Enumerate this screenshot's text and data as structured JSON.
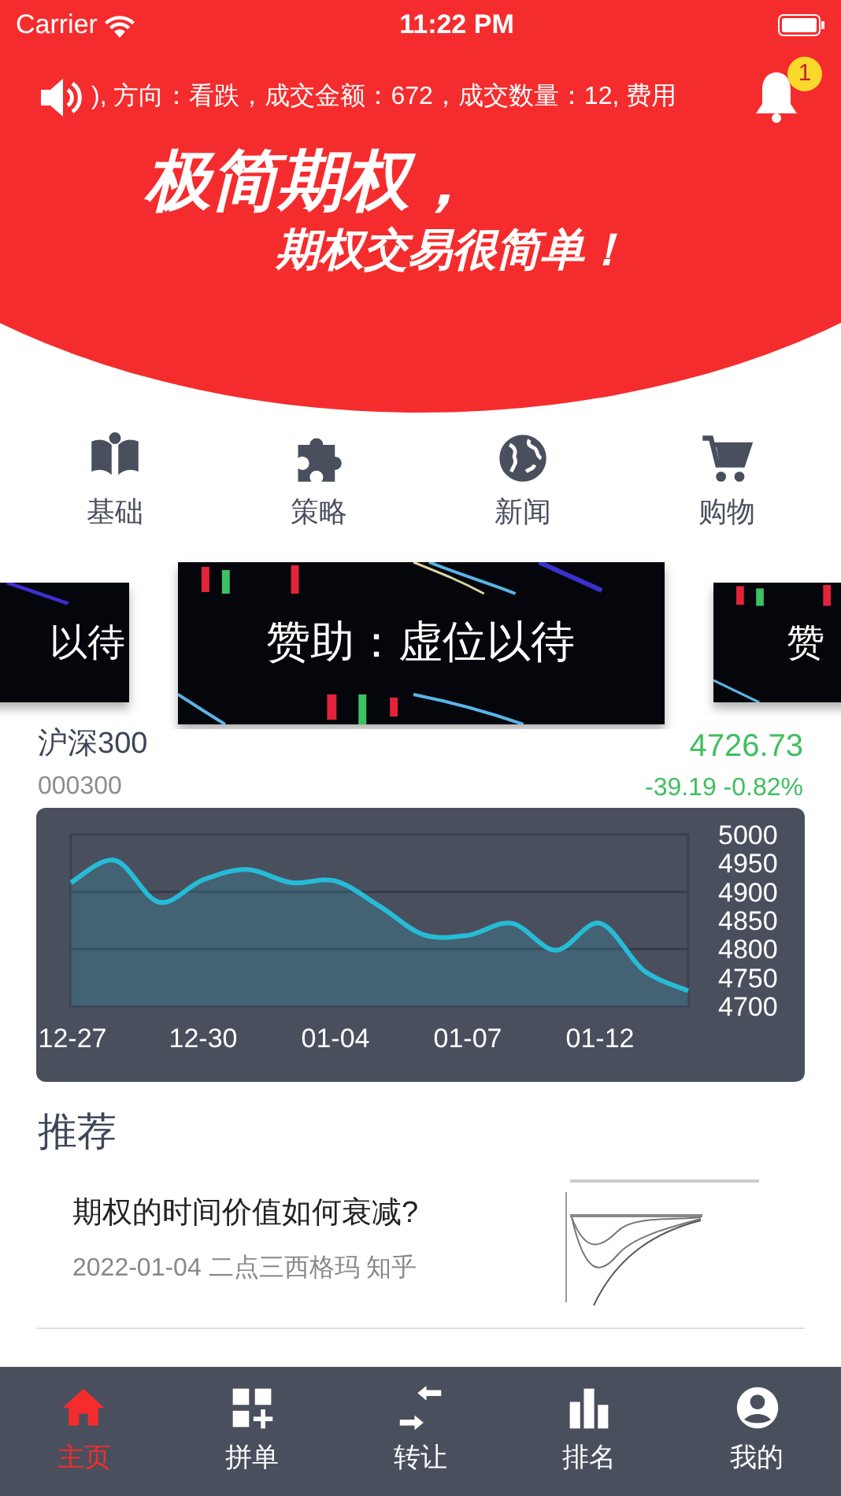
{
  "status_bar": {
    "carrier": "Carrier",
    "time": "11:22 PM"
  },
  "header": {
    "ticker": "), 方向：看跌，成交金额：672，成交数量：12, 费用",
    "notification_count": "1",
    "slogan_line_1": "极简期权，",
    "slogan_line_2": "期权交易很简单！"
  },
  "shortcuts": [
    {
      "kind": "book",
      "label": "基础"
    },
    {
      "kind": "puzzle",
      "label": "策略"
    },
    {
      "kind": "globe",
      "label": "新闻"
    },
    {
      "kind": "cart",
      "label": "购物"
    }
  ],
  "banners": [
    {
      "kind": "side-left",
      "caption": "以待"
    },
    {
      "kind": "center",
      "caption": "赞助：虚位以待"
    },
    {
      "kind": "side-right",
      "caption": "赞"
    }
  ],
  "index": {
    "name": "沪深300",
    "code": "000300",
    "price": "4726.73",
    "change": "-39.19 -0.82%"
  },
  "chart": {
    "chart_data": {
      "type": "area",
      "categories": [
        "12-27",
        null,
        null,
        "12-30",
        null,
        null,
        "01-04",
        null,
        null,
        "01-07",
        null,
        null,
        "01-12",
        null,
        null
      ],
      "series": [
        {
          "color": "#26bcd7",
          "values": [
            4916,
            4955,
            4882,
            4921,
            4939,
            4916,
            4919,
            4875,
            4825,
            4824,
            4845,
            4798,
            4845,
            4762,
            4727
          ]
        }
      ],
      "ylim": [
        4700,
        5000
      ],
      "yticks": [
        4700,
        4750,
        4800,
        4850,
        4900,
        4950,
        5000
      ]
    }
  },
  "recommend": {
    "heading": "推荐",
    "articles": [
      {
        "title": "期权的时间价值如何衰减?",
        "meta": "2022-01-04  二点三西格玛 知乎"
      }
    ]
  },
  "tab_bar": [
    {
      "kind": "home",
      "label": "主页",
      "selected": true
    },
    {
      "kind": "grid",
      "label": "拼单",
      "selected": false
    },
    {
      "kind": "transfer",
      "label": "转让",
      "selected": false
    },
    {
      "kind": "bars",
      "label": "排名",
      "selected": false
    },
    {
      "kind": "user",
      "label": "我的",
      "selected": false
    }
  ]
}
